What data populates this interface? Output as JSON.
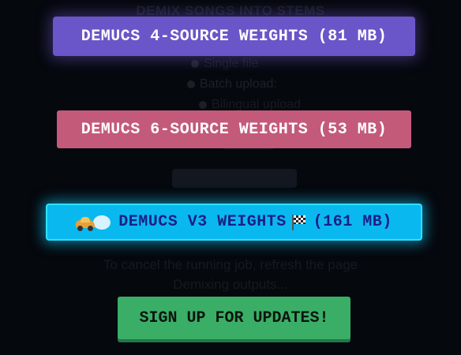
{
  "background": {
    "title": "DEMIX SONGS INTO STEMS",
    "radio_single": "Single file",
    "radio_batch": "Batch upload:",
    "radio_third": "Bilingual upload",
    "cancel_note": "To cancel the running job, refresh the page",
    "status": "Demixing outputs..."
  },
  "buttons": {
    "weights_4source": "DEMUCS 4-SOURCE WEIGHTS (81 MB)",
    "weights_6source": "DEMUCS 6-SOURCE WEIGHTS (53 MB)",
    "weights_v3_prefix": "DEMUCS V3 WEIGHTS",
    "weights_v3_suffix": "(161 MB)",
    "signup": "SIGN UP FOR UPDATES!"
  },
  "icons": {
    "v3_left": "racing-car-dash-icon",
    "v3_middle": "checkered-flag-icon"
  },
  "colors": {
    "background": "#05080d",
    "btn_4source": "#6a56c8",
    "btn_6source": "#c45a7a",
    "btn_v3": "#0ab8f0",
    "btn_v3_text": "#1a1f86",
    "btn_signup": "#3aae66"
  }
}
